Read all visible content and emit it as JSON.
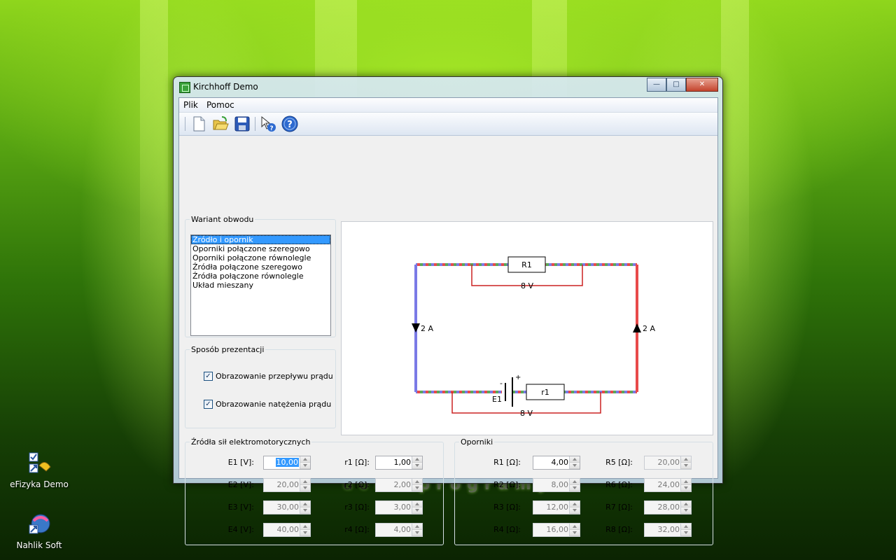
{
  "window": {
    "title": "Kirchhoff Demo",
    "minimize": "—",
    "maximize": "□",
    "close": "✕"
  },
  "menu": [
    "Plik",
    "Pomoc"
  ],
  "toolbar": {
    "icons": [
      "new-file-icon",
      "open-folder-icon",
      "save-icon",
      "help-pointer-icon",
      "help-icon"
    ]
  },
  "variant": {
    "legend": "Wariant obwodu",
    "items": [
      "Źródło i opornik",
      "Oporniki połączone szeregowo",
      "Oporniki połączone równolegle",
      "Źródła połączone szeregowo",
      "Źródła połączone równolegle",
      "Układ mieszany"
    ],
    "selected_index": 0
  },
  "presentation": {
    "legend": "Sposób prezentacji",
    "options": [
      {
        "label": "Obrazowanie przepływu prądu",
        "checked": true,
        "mark": "✓"
      },
      {
        "label": "Obrazowanie natężenia prądu",
        "checked": true,
        "mark": "✓"
      }
    ]
  },
  "circuit": {
    "r1_label": "R1",
    "r1_voltage": "8 V",
    "left_current": "2 A",
    "right_current": "2 A",
    "source_label": "E1",
    "source_minus": "-",
    "source_plus": "+",
    "internal_label": "r1",
    "bottom_voltage": "8 V",
    "colors": {
      "wire_a": "#e84a4a",
      "wire_b": "#5aa85a",
      "wire_c": "#7a7ae6",
      "measure": "#cc2222"
    }
  },
  "emf": {
    "legend": "Źródła sił elektromotorycznych",
    "rows": [
      {
        "e_label": "E1 [V]:",
        "e_value": "10,00",
        "r_label": "r1 [Ω]:",
        "r_value": "1,00",
        "enabled": true
      },
      {
        "e_label": "E2 [V]:",
        "e_value": "20,00",
        "r_label": "r2 [Ω]:",
        "r_value": "2,00",
        "enabled": false
      },
      {
        "e_label": "E3 [V]:",
        "e_value": "30,00",
        "r_label": "r3 [Ω]:",
        "r_value": "3,00",
        "enabled": false
      },
      {
        "e_label": "E4 [V]:",
        "e_value": "40,00",
        "r_label": "r4 [Ω]:",
        "r_value": "4,00",
        "enabled": false
      }
    ]
  },
  "resistors": {
    "legend": "Oporniki",
    "left": [
      {
        "label": "R1 [Ω]:",
        "value": "4,00",
        "enabled": true
      },
      {
        "label": "R2 [Ω]:",
        "value": "8,00",
        "enabled": false
      },
      {
        "label": "R3 [Ω]:",
        "value": "12,00",
        "enabled": false
      },
      {
        "label": "R4 [Ω]:",
        "value": "16,00",
        "enabled": false
      }
    ],
    "right": [
      {
        "label": "R5 [Ω]:",
        "value": "20,00",
        "enabled": false
      },
      {
        "label": "R6 [Ω]:",
        "value": "24,00",
        "enabled": false
      },
      {
        "label": "R7 [Ω]:",
        "value": "28,00",
        "enabled": false
      },
      {
        "label": "R8 [Ω]:",
        "value": "32,00",
        "enabled": false
      }
    ]
  },
  "desktop": {
    "icons": [
      {
        "label": "eFizyka Demo"
      },
      {
        "label": "Nahlik Soft"
      }
    ],
    "watermark_light": "dobre",
    "watermark_bold": "programy"
  }
}
